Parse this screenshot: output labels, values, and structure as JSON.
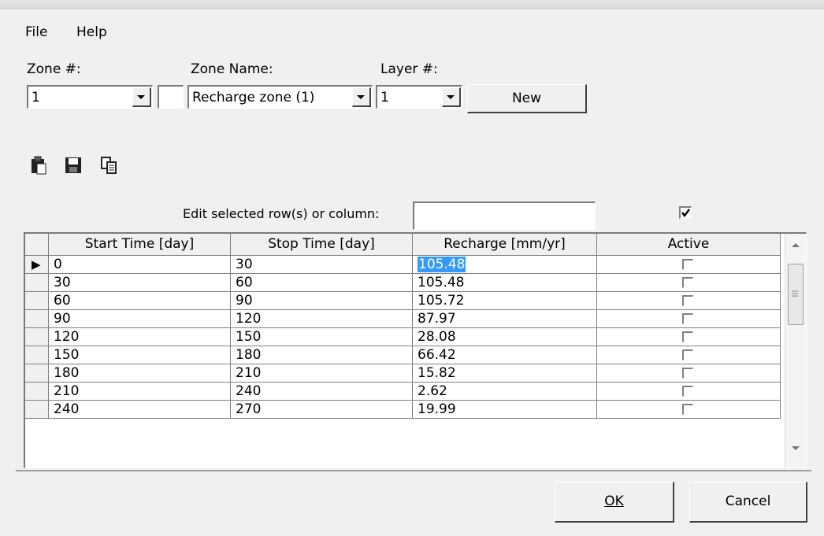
{
  "menu": {
    "file": "File",
    "help": "Help"
  },
  "zone": {
    "label": "Zone #:",
    "value": "1"
  },
  "zone_name": {
    "label": "Zone Name:",
    "value": "Recharge zone (1)"
  },
  "layer": {
    "label": "Layer #:",
    "value": "1"
  },
  "new_button": "New",
  "toolbar": {
    "icons": [
      "paste-icon",
      "save-icon",
      "copy-icon"
    ]
  },
  "edit": {
    "label": "Edit selected row(s) or column:",
    "value": "",
    "checkbox_checked": true
  },
  "table": {
    "columns": [
      "Start Time [day]",
      "Stop Time [day]",
      "Recharge [mm/yr]",
      "Active"
    ],
    "rows": [
      {
        "start": "0",
        "stop": "30",
        "recharge": "105.48",
        "active": false
      },
      {
        "start": "30",
        "stop": "60",
        "recharge": "105.48",
        "active": false
      },
      {
        "start": "60",
        "stop": "90",
        "recharge": "105.72",
        "active": false
      },
      {
        "start": "90",
        "stop": "120",
        "recharge": "87.97",
        "active": false
      },
      {
        "start": "120",
        "stop": "150",
        "recharge": "28.08",
        "active": false
      },
      {
        "start": "150",
        "stop": "180",
        "recharge": "66.42",
        "active": false
      },
      {
        "start": "180",
        "stop": "210",
        "recharge": "15.82",
        "active": false
      },
      {
        "start": "210",
        "stop": "240",
        "recharge": "2.62",
        "active": false
      },
      {
        "start": "240",
        "stop": "270",
        "recharge": "19.99",
        "active": false
      }
    ],
    "current_row_marker": "▶"
  },
  "buttons": {
    "ok": "OK",
    "cancel": "Cancel"
  }
}
